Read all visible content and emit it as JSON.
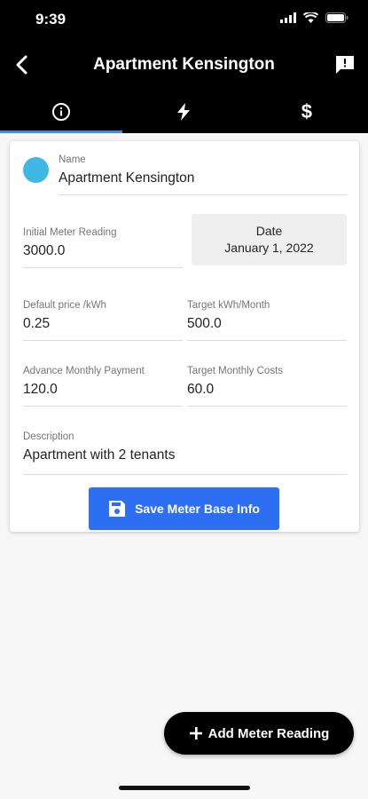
{
  "status": {
    "time": "9:39"
  },
  "header": {
    "title": "Apartment Kensington"
  },
  "tabs": [
    {
      "name": "info",
      "icon": "info-icon"
    },
    {
      "name": "readings",
      "icon": "bolt-icon"
    },
    {
      "name": "costs",
      "icon": "dollar-icon"
    }
  ],
  "form": {
    "name": {
      "label": "Name",
      "value": "Apartment Kensington"
    },
    "initial_reading": {
      "label": "Initial Meter Reading",
      "value": "3000.0"
    },
    "date": {
      "label": "Date",
      "value": "January 1, 2022"
    },
    "default_price": {
      "label": "Default price /kWh",
      "value": "0.25"
    },
    "target_kwh": {
      "label": "Target kWh/Month",
      "value": "500.0"
    },
    "advance_payment": {
      "label": "Advance Monthly Payment",
      "value": "120.0"
    },
    "target_costs": {
      "label": "Target Monthly Costs",
      "value": "60.0"
    },
    "description": {
      "label": "Description",
      "value": "Apartment with 2 tenants"
    },
    "save_label": "Save Meter Base Info",
    "avatar_color": "#3fb7e4"
  },
  "fab": {
    "label": "Add Meter Reading"
  },
  "colors": {
    "accent": "#2c6ff2",
    "tab_indicator": "#3b8fe0"
  }
}
